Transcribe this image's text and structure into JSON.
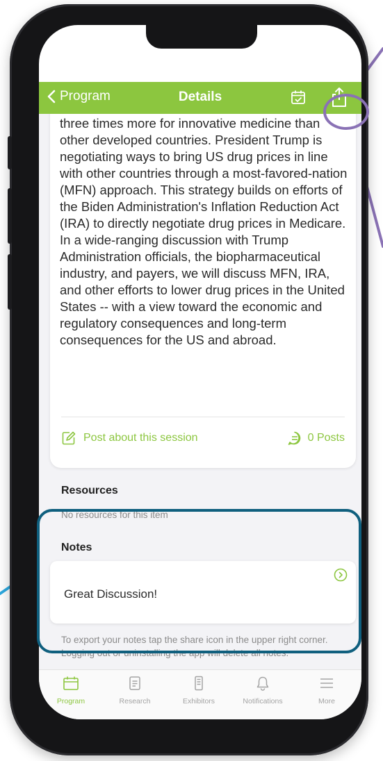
{
  "nav": {
    "back_label": "Program",
    "title": "Details"
  },
  "session": {
    "description": "Americans have run out of patience with paying three times more for innovative medicine than other developed countries.  President Trump is negotiating ways to bring US drug prices in line with other countries through a most-favored-nation (MFN) approach.  This strategy builds on efforts of the Biden Administration's Inflation Reduction Act (IRA) to directly negotiate drug prices in Medicare.  In a wide-ranging discussion with Trump Administration officials, the biopharmaceutical industry, and payers, we will discuss MFN, IRA, and other efforts to lower drug prices in the United States -- with a view toward the economic and regulatory consequences and long-term consequences for the US and abroad.",
    "post_label": "Post about this session",
    "posts_count": "0 Posts"
  },
  "resources": {
    "heading": "Resources",
    "empty_text": "No resources for this item"
  },
  "notes": {
    "heading": "Notes",
    "note_text": "Great Discussion!",
    "export_text": "To export your notes tap the share icon in the upper right corner. Logging out or uninstalling the app will delete all notes."
  },
  "tabs": [
    {
      "label": "Program",
      "icon": "calendar-icon"
    },
    {
      "label": "Research",
      "icon": "document-icon"
    },
    {
      "label": "Exhibitors",
      "icon": "booth-icon"
    },
    {
      "label": "Notifications",
      "icon": "bell-icon"
    },
    {
      "label": "More",
      "icon": "menu-icon"
    }
  ],
  "colors": {
    "accent": "#8cc63f",
    "annotation_circle": "#8a72b5",
    "annotation_box": "#0f5f7e",
    "annotation_line_left": "#2ea9df"
  }
}
